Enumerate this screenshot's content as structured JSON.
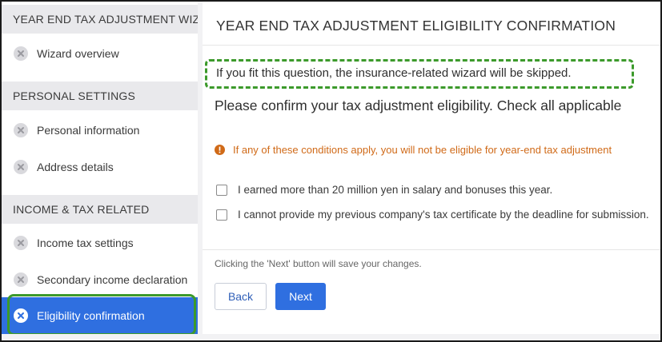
{
  "sidebar": {
    "sections": [
      {
        "title": "YEAR END TAX ADJUSTMENT WIZARD",
        "items": [
          {
            "label": "Wizard overview",
            "icon": "close-circle-icon"
          }
        ]
      },
      {
        "title": "PERSONAL SETTINGS",
        "items": [
          {
            "label": "Personal information",
            "icon": "close-circle-icon"
          },
          {
            "label": "Address details",
            "icon": "close-circle-icon"
          }
        ]
      },
      {
        "title": "INCOME & TAX RELATED",
        "items": [
          {
            "label": "Income tax settings",
            "icon": "close-circle-icon"
          },
          {
            "label": "Secondary income declaration",
            "icon": "close-circle-icon"
          },
          {
            "label": "Eligibility confirmation",
            "icon": "close-circle-icon",
            "active": true
          }
        ]
      }
    ]
  },
  "main": {
    "title": "YEAR END TAX ADJUSTMENT ELIGIBILITY CONFIRMATION",
    "callout": "If you fit this question, the insurance-related wizard will be skipped.",
    "instruction": "Please confirm your tax adjustment eligibility. Check all applicable",
    "warning": "If any of these conditions apply, you will not be eligible for year-end tax adjustment",
    "conditions": [
      {
        "label": "I earned more than 20 million yen in salary and bonuses this year.",
        "checked": false
      },
      {
        "label": "I cannot provide my previous company's tax certificate by the deadline for submission.",
        "checked": false
      }
    ],
    "save_note": "Clicking the 'Next' button will save your changes.",
    "back_label": "Back",
    "next_label": "Next"
  },
  "colors": {
    "accent": "#2f6fe0",
    "highlight_outline": "#3c9a2b",
    "warning": "#d06a18",
    "section_header_bg": "#e9e9ec"
  }
}
